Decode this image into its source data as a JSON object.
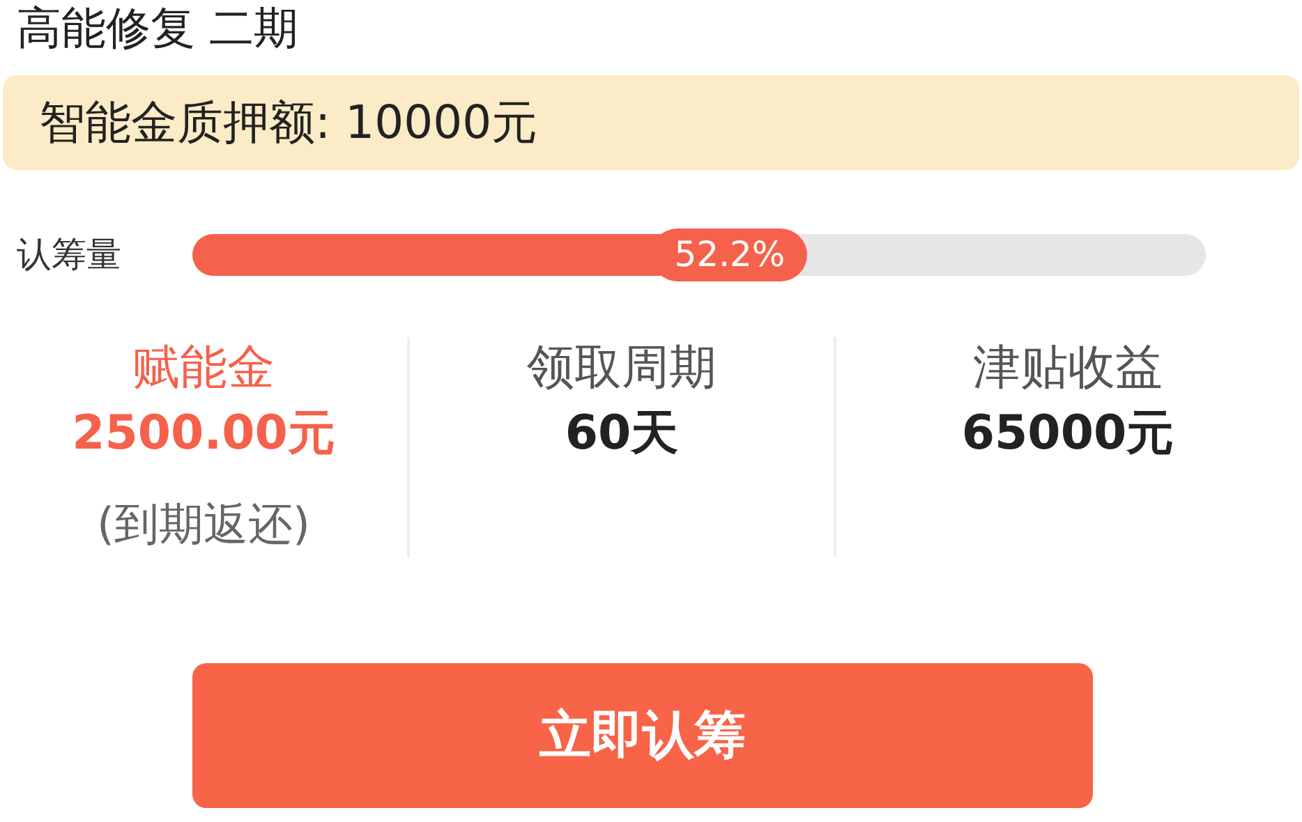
{
  "title": "高能修复 二期",
  "banner": "智能金质押额: 10000元",
  "subscription": {
    "label": "认筹量",
    "level": 0.522,
    "reading": "52.2%"
  },
  "stats": [
    {
      "label": "赋能金",
      "value": "2500.00元",
      "note": "(到期返还)",
      "highlight": true
    },
    {
      "label": "领取周期",
      "value": "60天",
      "highlight": false
    },
    {
      "label": "津贴收益",
      "value": "65000元",
      "highlight": false
    }
  ],
  "button": "立即认筹"
}
